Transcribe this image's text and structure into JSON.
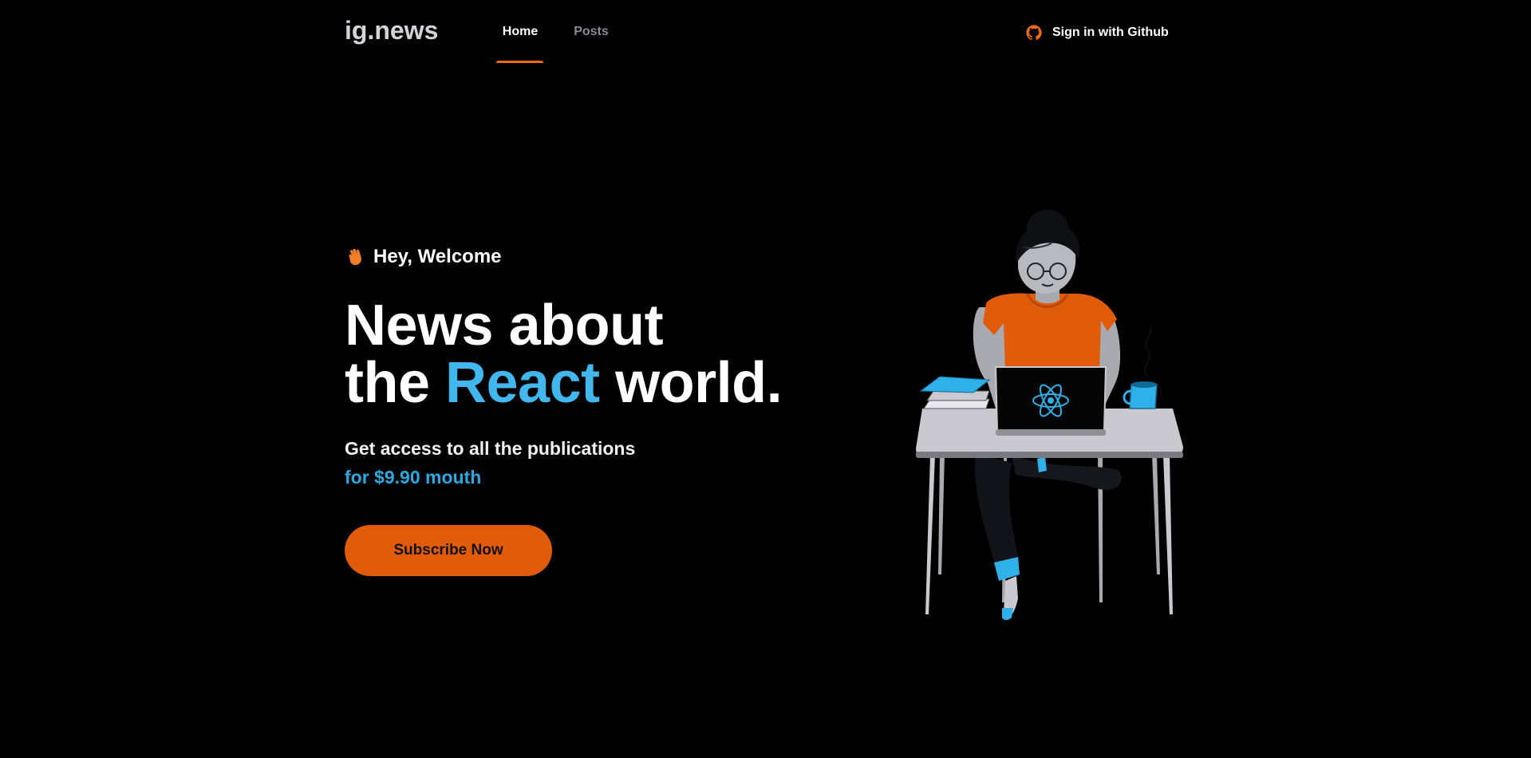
{
  "header": {
    "logo": "ig.news",
    "nav": [
      {
        "label": "Home",
        "active": true
      },
      {
        "label": "Posts",
        "active": false
      }
    ],
    "signin_label": "Sign in with Github"
  },
  "hero": {
    "welcome": "Hey, Welcome",
    "headline_line1": "News about",
    "headline_the": "the",
    "headline_react": "React",
    "headline_world": "world.",
    "subtitle": "Get access to all the publications",
    "price": "for $9.90 mouth",
    "cta": "Subscribe Now"
  },
  "colors": {
    "background": "#000000",
    "accent_orange": "#e05c0b",
    "accent_blue": "#41b7ed"
  },
  "icons": {
    "github": "github-icon",
    "wave": "waving-hand-icon"
  }
}
